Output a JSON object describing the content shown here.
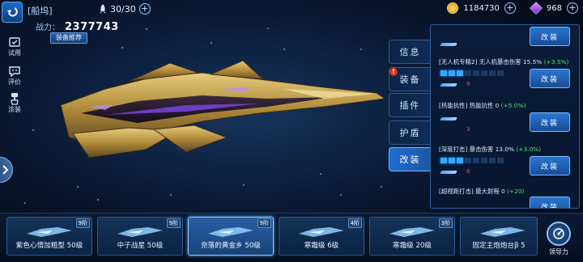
{
  "header": {
    "title": "[船坞]",
    "fleet_count": "30/30",
    "credits": "1184730",
    "gems": "968"
  },
  "power": {
    "label": "战力：",
    "value": "2377743",
    "recommend_label": "装备推荐"
  },
  "side_menu": [
    {
      "icon": "ship-trial-icon",
      "label": "试用"
    },
    {
      "icon": "rating-icon",
      "label": "评价"
    },
    {
      "icon": "paint-icon",
      "label": "涂装"
    }
  ],
  "tabs": [
    {
      "label": "信息",
      "active": false,
      "alert": false
    },
    {
      "label": "装备",
      "active": false,
      "alert": true
    },
    {
      "label": "插件",
      "active": false,
      "alert": false
    },
    {
      "label": "护盾",
      "active": false,
      "alert": false
    },
    {
      "label": "改装",
      "active": true,
      "alert": false
    }
  ],
  "tab_alert_mark": "!",
  "mod_panel": {
    "button_label": "改装",
    "top_partial_count": "",
    "stats": [
      {
        "title": "[无人机专精2] 无人机暴击伤害 15.5%",
        "bonus": "(+3.5%)",
        "pips_filled": 3,
        "pips_total": 8,
        "count": "8"
      },
      {
        "title": "[热能抗性] 热能抗性 0",
        "bonus": "(+5.0%)",
        "pips_filled": 0,
        "pips_total": 8,
        "count": "3"
      },
      {
        "title": "[深度打击] 暴击伤害 13.0%",
        "bonus": "(+3.0%)",
        "pips_filled": 3,
        "pips_total": 8,
        "count": "8"
      },
      {
        "title": "[超视距打击] 最大射程 0",
        "bonus": "(+20)",
        "pips_filled": 0,
        "pips_total": 8,
        "count": ""
      }
    ]
  },
  "ship_cards": [
    {
      "name": "紫色心情加粗型 50级",
      "rank": "9阶",
      "selected": false
    },
    {
      "name": "中子战星 50级",
      "rank": "9阶",
      "selected": false
    },
    {
      "name": "奈落的黄金乡 50级",
      "rank": "9阶",
      "selected": true
    },
    {
      "name": "寒霜级 6级",
      "rank": "4阶",
      "selected": false
    },
    {
      "name": "寒霜级 20级",
      "rank": "3阶",
      "selected": false
    },
    {
      "name": "固定主炮炮台β 5",
      "rank": "",
      "selected": false
    }
  ],
  "leadership_label": "领导力",
  "colors": {
    "accent": "#1f6ed0",
    "bonus_green": "#54e06a",
    "count_red": "#ff4848",
    "hull_gold": "#c9a64a",
    "glow_purple": "#8a4dff"
  }
}
